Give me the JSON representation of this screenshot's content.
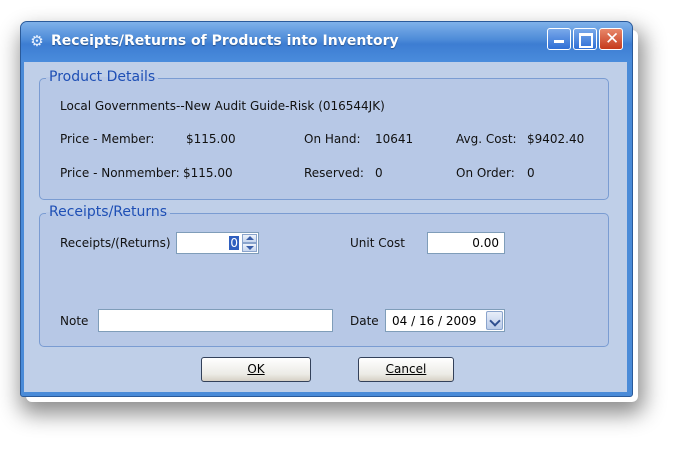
{
  "window": {
    "title": "Receipts/Returns of Products into Inventory",
    "icon": "gear-icon",
    "controls": [
      "minimize-icon",
      "maximize-icon",
      "close-icon"
    ]
  },
  "product_details": {
    "legend": "Product Details",
    "product_name": "Local Governments--New Audit Guide-Risk (016544JK)",
    "price_member_label": "Price - Member:",
    "price_member_value": "$115.00",
    "price_nonmember_label": "Price - Nonmember:",
    "price_nonmember_value": "$115.00",
    "on_hand_label": "On Hand:",
    "on_hand_value": "10641",
    "reserved_label": "Reserved:",
    "reserved_value": "0",
    "avg_cost_label": "Avg. Cost:",
    "avg_cost_value": "$9402.40",
    "on_order_label": "On Order:",
    "on_order_value": "0"
  },
  "receipts": {
    "legend": "Receipts/Returns",
    "receipts_label": "Receipts/(Returns)",
    "receipts_value": "0",
    "unit_cost_label": "Unit Cost",
    "unit_cost_value": "0.00",
    "note_label": "Note",
    "note_value": "",
    "date_label": "Date",
    "date_value": "04 / 16 / 2009"
  },
  "buttons": {
    "ok_label": "OK",
    "cancel_label": "Cancel"
  },
  "colors": {
    "titlebar": "#4c8ad8",
    "client_bg": "#bfcfe8",
    "legend_text": "#1e4fb5"
  }
}
